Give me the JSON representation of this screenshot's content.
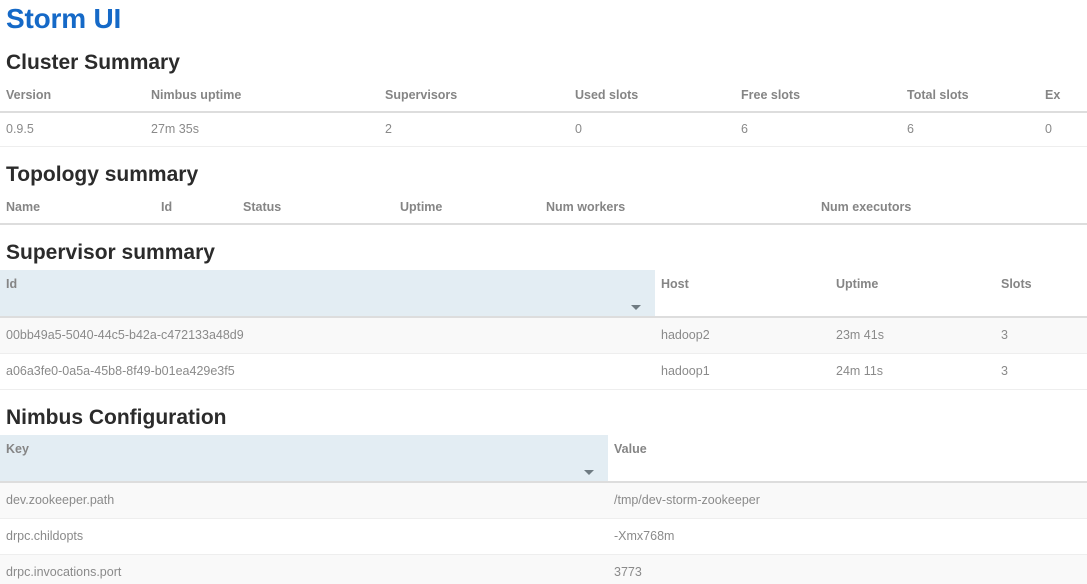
{
  "app": {
    "title": "Storm UI",
    "accent_color": "#1569c7",
    "heading_color": "#2b2b2b",
    "sorted_header_bg": "#e3edf3",
    "row_stripe_bg": "#f9f9f9"
  },
  "cluster_summary": {
    "heading": "Cluster Summary",
    "columns": [
      "Version",
      "Nimbus uptime",
      "Supervisors",
      "Used slots",
      "Free slots",
      "Total slots",
      "Ex"
    ],
    "rows": [
      [
        "0.9.5",
        "27m 35s",
        "2",
        "0",
        "6",
        "6",
        "0"
      ]
    ]
  },
  "topology_summary": {
    "heading": "Topology summary",
    "columns": [
      "Name",
      "Id",
      "Status",
      "Uptime",
      "Num workers",
      "Num executors"
    ],
    "rows": []
  },
  "supervisor_summary": {
    "heading": "Supervisor summary",
    "columns": [
      "Id",
      "Host",
      "Uptime",
      "Slots"
    ],
    "sorted_column": "Id",
    "sort_icon": "chevron-down-icon",
    "rows": [
      [
        "00bb49a5-5040-44c5-b42a-c472133a48d9",
        "hadoop2",
        "23m 41s",
        "3"
      ],
      [
        "a06a3fe0-0a5a-45b8-8f49-b01ea429e3f5",
        "hadoop1",
        "24m 11s",
        "3"
      ]
    ]
  },
  "nimbus_configuration": {
    "heading": "Nimbus Configuration",
    "columns": [
      "Key",
      "Value"
    ],
    "sorted_column": "Key",
    "sort_icon": "chevron-down-icon",
    "rows": [
      [
        "dev.zookeeper.path",
        "/tmp/dev-storm-zookeeper"
      ],
      [
        "drpc.childopts",
        "-Xmx768m"
      ],
      [
        "drpc.invocations.port",
        "3773"
      ]
    ]
  }
}
